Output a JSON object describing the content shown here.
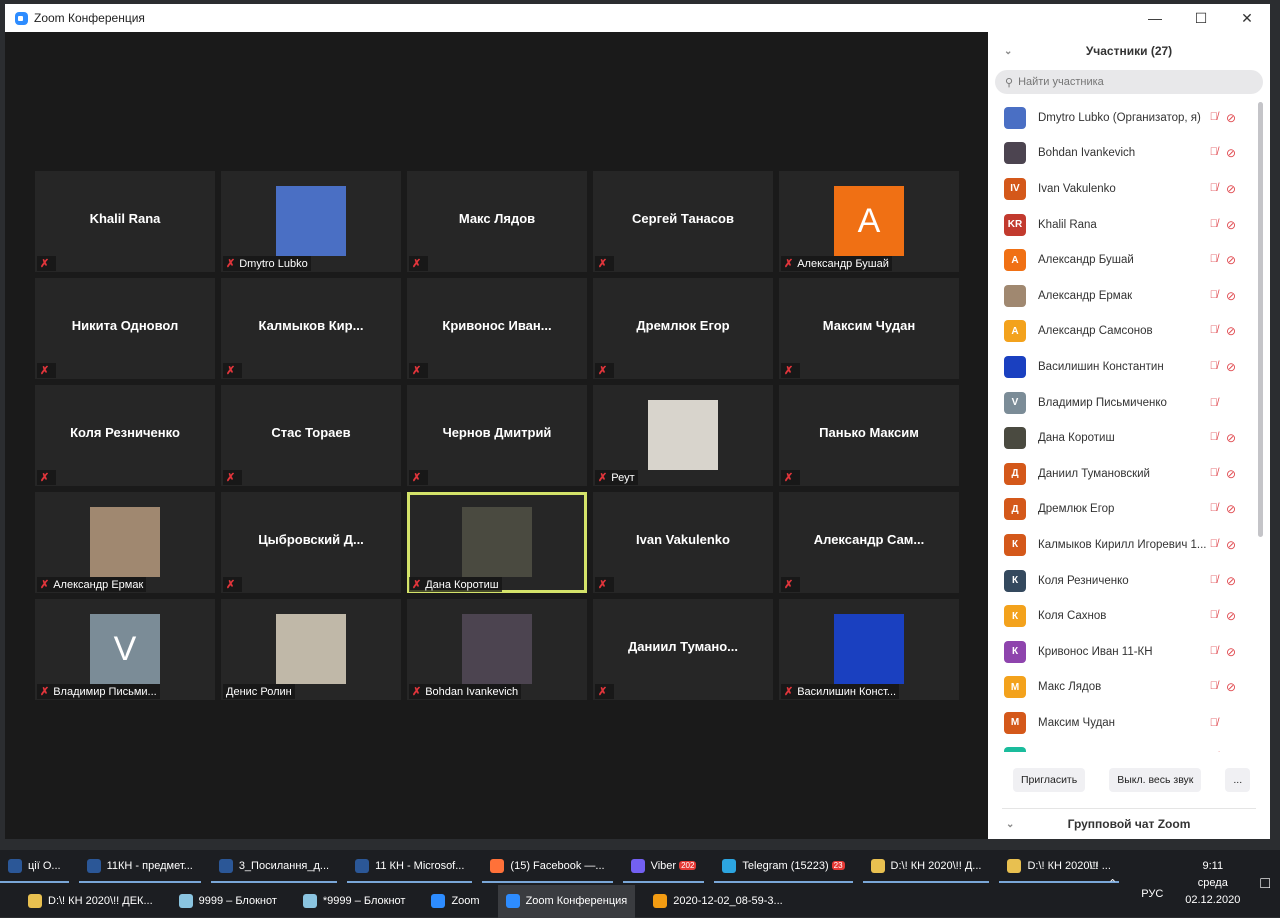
{
  "window": {
    "title": "Zoom Конференция",
    "controls": [
      "—",
      "☐",
      "✕"
    ]
  },
  "tiles": [
    {
      "center": "Khalil Rana",
      "muted": true
    },
    {
      "label": "Dmytro Lubko",
      "pic": "photo",
      "color": "#4a6fc4",
      "muted": true
    },
    {
      "center": "Макс Лядов",
      "muted": true
    },
    {
      "center": "Сергей Танасов",
      "muted": true
    },
    {
      "label": "Александр Бушай",
      "pic": "letter",
      "letter": "A",
      "color": "#f07014",
      "muted": true
    },
    {
      "center": "Никита Одновол",
      "muted": true
    },
    {
      "center": "Калмыков  Кир...",
      "muted": true
    },
    {
      "center": "Кривонос  Иван...",
      "muted": true
    },
    {
      "center": "Дремлюк Егор",
      "muted": true
    },
    {
      "center": "Максим Чудан",
      "muted": true
    },
    {
      "center": "Коля Резниченко",
      "muted": true
    },
    {
      "center": "Стас Тораев",
      "muted": true
    },
    {
      "center": "Чернов Дмитрий",
      "muted": true
    },
    {
      "label": "Реут",
      "pic": "photo",
      "color": "#d8d4cc",
      "muted": true
    },
    {
      "center": "Панько Максим",
      "muted": true
    },
    {
      "label": "Александр Ермак",
      "pic": "photo",
      "color": "#a08870",
      "muted": true
    },
    {
      "center": "Цыбровский  Д...",
      "muted": true
    },
    {
      "label": "Дана Коротиш",
      "pic": "photo",
      "color": "#4a4a40",
      "muted": true,
      "active": true
    },
    {
      "center": "Ivan Vakulenko",
      "muted": true
    },
    {
      "center": "Александр  Сам...",
      "muted": true
    },
    {
      "label": "Владимир Письми...",
      "pic": "letter",
      "letter": "V",
      "color": "#7b8c97",
      "muted": true
    },
    {
      "label": "Денис Ролин",
      "pic": "photo",
      "color": "#c0b8a8",
      "muted": false
    },
    {
      "label": "Bohdan Ivankevich",
      "pic": "photo",
      "color": "#4c4450",
      "muted": true
    },
    {
      "center": "Даниил  Тумано...",
      "muted": true
    },
    {
      "label": "Василишин Конст...",
      "pic": "photo",
      "color": "#1a40c0",
      "muted": true
    }
  ],
  "panel": {
    "title": "Участники (27)",
    "search_placeholder": "Найти участника",
    "participants": [
      {
        "name": "Dmytro Lubko (Организатор, я)",
        "avatar": "",
        "color": "#4a6fc4",
        "video_off": true
      },
      {
        "name": "Bohdan Ivankevich",
        "avatar": "",
        "color": "#4c4450",
        "video_off": true
      },
      {
        "name": "Ivan Vakulenko",
        "avatar": "IV",
        "color": "#d4581a",
        "video_off": true
      },
      {
        "name": "Khalil Rana",
        "avatar": "KR",
        "color": "#c23a2e",
        "video_off": true
      },
      {
        "name": "Александр Бушай",
        "avatar": "A",
        "color": "#f07014",
        "video_off": true
      },
      {
        "name": "Александр Ермак",
        "avatar": "",
        "color": "#a08870",
        "video_off": true
      },
      {
        "name": "Александр Самсонов",
        "avatar": "A",
        "color": "#f3a21c",
        "video_off": true
      },
      {
        "name": "Василишин Константин",
        "avatar": "",
        "color": "#1a40c0",
        "video_off": true
      },
      {
        "name": "Владимир Письмиченко",
        "avatar": "V",
        "color": "#7b8c97",
        "video_off": false
      },
      {
        "name": "Дана Коротиш",
        "avatar": "",
        "color": "#4a4a40",
        "video_off": true
      },
      {
        "name": "Даниил Тумановский",
        "avatar": "Д",
        "color": "#d4581a",
        "video_off": true
      },
      {
        "name": "Дремлюк Егор",
        "avatar": "Д",
        "color": "#d4581a",
        "video_off": true
      },
      {
        "name": "Калмыков Кирилл Игоревич 1...",
        "avatar": "К",
        "color": "#d4581a",
        "video_off": true
      },
      {
        "name": "Коля Резниченко",
        "avatar": "К",
        "color": "#34495e",
        "video_off": true
      },
      {
        "name": "Коля Сахнов",
        "avatar": "К",
        "color": "#f3a21c",
        "video_off": true
      },
      {
        "name": "Кривонос Иван 11-КН",
        "avatar": "К",
        "color": "#8e44ad",
        "video_off": true
      },
      {
        "name": "Макс Лядов",
        "avatar": "М",
        "color": "#f3a21c",
        "video_off": true
      },
      {
        "name": "Максим Чудан",
        "avatar": "М",
        "color": "#d4581a",
        "video_off": false
      },
      {
        "name": "",
        "avatar": "",
        "color": "#1abc9c",
        "video_off": true
      }
    ],
    "invite": "Пригласить",
    "mute_all": "Выкл. весь звук",
    "more": "...",
    "chat_title": "Групповой чат Zoom"
  },
  "taskbar": {
    "row1": [
      {
        "label": "ції О...",
        "color": "#2b5797"
      },
      {
        "label": "11КН - предмет...",
        "color": "#2b5797"
      },
      {
        "label": "3_Посилання_д...",
        "color": "#2b5797"
      },
      {
        "label": "11 КН - Microsof...",
        "color": "#2b5797"
      },
      {
        "label": "(15) Facebook —...",
        "color": "#ff7139"
      },
      {
        "label": "Viber",
        "color": "#7360f2",
        "badge": "202"
      },
      {
        "label": "Telegram (15223)",
        "color": "#2ca5e0",
        "badge": "23"
      },
      {
        "label": "D:\\!  КН 2020\\!! Д...",
        "color": "#e8c050"
      },
      {
        "label": "D:\\!  КН 2020\\!! ...",
        "color": "#e8c050"
      }
    ],
    "row2": [
      {
        "label": "D:\\!  КН 2020\\!! ДЕК...",
        "color": "#e8c050"
      },
      {
        "label": "9999 – Блокнот",
        "color": "#8ac4e0"
      },
      {
        "label": "*9999 – Блокнот",
        "color": "#8ac4e0"
      },
      {
        "label": "Zoom",
        "color": "#2d8cff"
      },
      {
        "label": "Zoom Конференция",
        "color": "#2d8cff",
        "selected": true
      },
      {
        "label": "2020-12-02_08-59-3...",
        "color": "#f39c12"
      }
    ],
    "lang": "РУС",
    "time": "9:11",
    "day": "среда",
    "date": "02.12.2020"
  }
}
